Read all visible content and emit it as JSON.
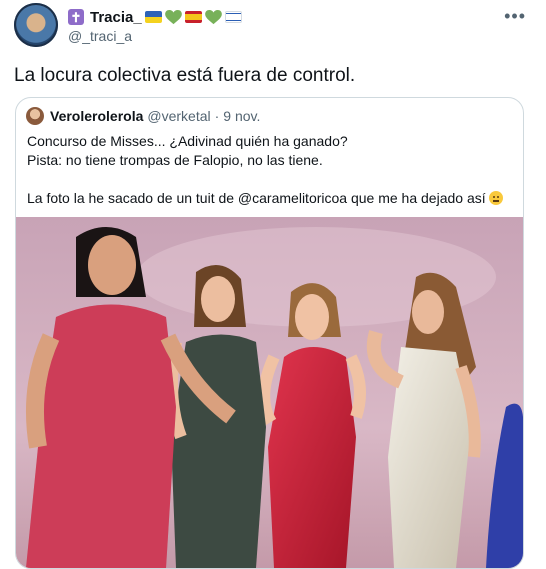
{
  "author": {
    "display_name": "Tracia_",
    "handle": "@_traci_a",
    "name_emojis": [
      "latin-cross-emoji",
      "flag-ukraine",
      "green-heart",
      "flag-spain",
      "green-heart",
      "flag-israel"
    ]
  },
  "tweet": {
    "text": "La locura colectiva está fuera de control."
  },
  "quoted": {
    "display_name": "Verolerolerola",
    "handle": "@verketal",
    "separator": "·",
    "date": "9 nov.",
    "lines": [
      "Concurso de Misses... ¿Adivinad quién ha ganado?",
      "Pista: no tiene trompas de Falopio, no las tiene.",
      "La foto la he sacado de un tuit de @caramelitoricoa que me ha dejado así"
    ]
  },
  "colors": {
    "text": "#0f1419",
    "secondary": "#536471",
    "border": "#cfd9de",
    "green_heart": "#78b159"
  },
  "icons": {
    "more": "more-horizontal-icon",
    "emoji": "neutral-face-emoji"
  }
}
